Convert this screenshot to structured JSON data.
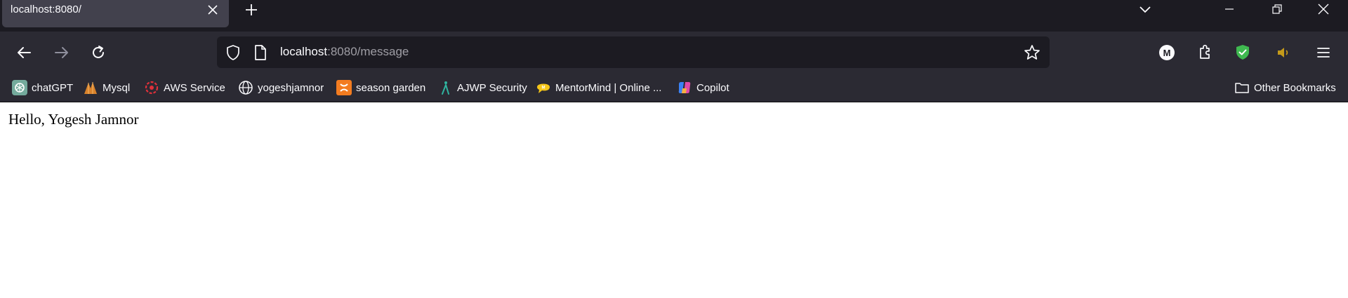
{
  "tab": {
    "title": "localhost:8080/"
  },
  "urlbar": {
    "host": "localhost",
    "rest": ":8080/message"
  },
  "bookmarks": [
    {
      "label": "chatGPT",
      "icon": "chatgpt-icon"
    },
    {
      "label": "Mysql",
      "icon": "mysql-icon"
    },
    {
      "label": "AWS Service",
      "icon": "aws-icon"
    },
    {
      "label": "yogeshjamnor",
      "icon": "globe-icon"
    },
    {
      "label": "season garden",
      "icon": "xampp-icon"
    },
    {
      "label": "AJWP Security",
      "icon": "ajwp-icon"
    },
    {
      "label": "MentorMind | Online ...",
      "icon": "mentormind-icon"
    },
    {
      "label": "Copilot",
      "icon": "copilot-icon"
    }
  ],
  "other_bookmarks": {
    "label": "Other Bookmarks"
  },
  "toolbar": {
    "account_initial": "M"
  },
  "page": {
    "message": "Hello, Yogesh Jamnor"
  }
}
